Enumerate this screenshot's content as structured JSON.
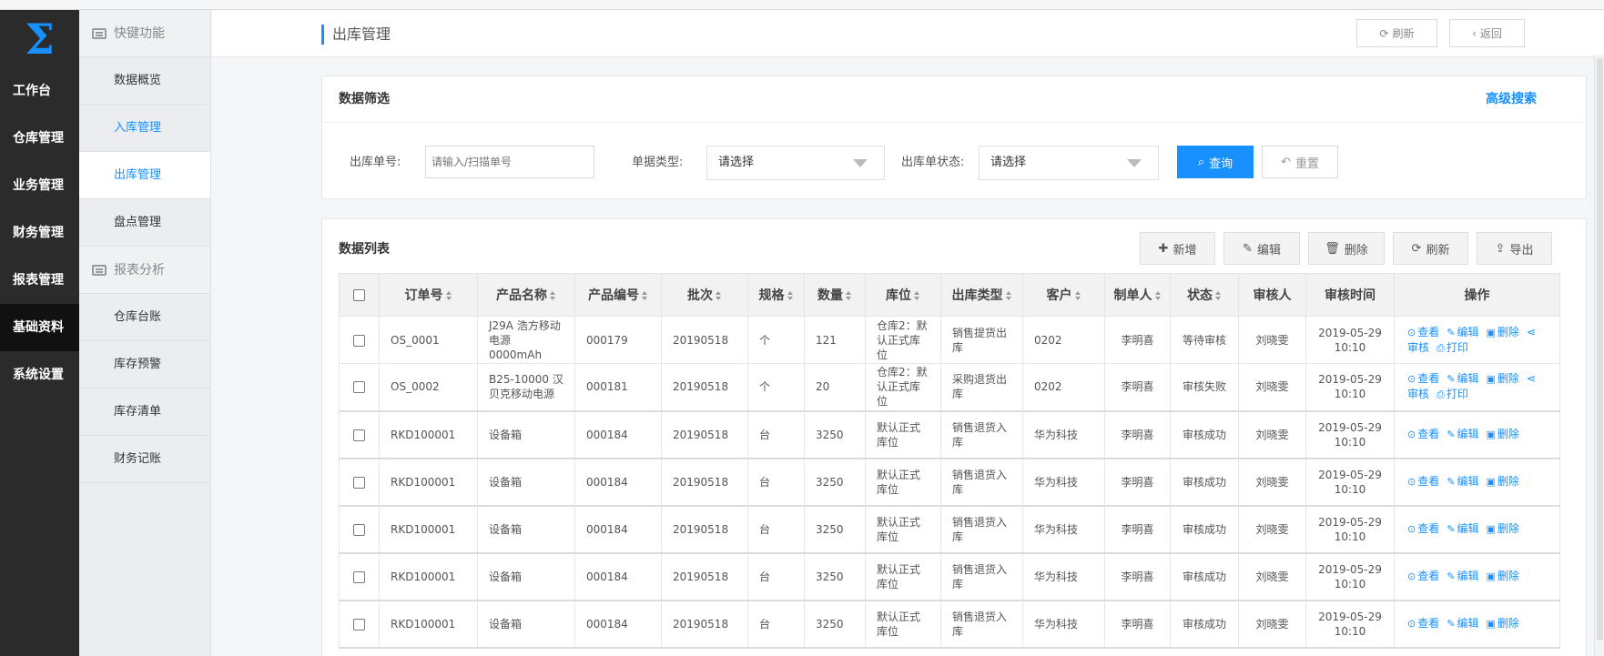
{
  "logo": {
    "glyph": "Σ"
  },
  "nav": [
    {
      "label": "工作台",
      "name": "nav-workbench"
    },
    {
      "label": "仓库管理",
      "name": "nav-warehouse"
    },
    {
      "label": "业务管理",
      "name": "nav-business"
    },
    {
      "label": "财务管理",
      "name": "nav-finance"
    },
    {
      "label": "报表管理",
      "name": "nav-report"
    },
    {
      "label": "基础资料",
      "name": "nav-basic"
    },
    {
      "label": "系统设置",
      "name": "nav-settings"
    }
  ],
  "subnav": {
    "group1": "快键功能",
    "items1": [
      "数据概览",
      "入库管理",
      "出库管理",
      "盘点管理"
    ],
    "group2": "报表分析",
    "items2": [
      "仓库台账",
      "库存预警",
      "库存清单",
      "财务记账"
    ]
  },
  "header": {
    "title": "出库管理",
    "refresh": "刷新",
    "back": "返回"
  },
  "filter": {
    "title": "数据筛选",
    "advanced": "高级搜索",
    "order_label": "出库单号:",
    "order_placeholder": "请输入/扫描单号",
    "type_label": "单据类型:",
    "type_value": "请选择",
    "status_label": "出库单状态:",
    "status_value": "请选择",
    "query": "查询",
    "reset": "重置"
  },
  "list": {
    "title": "数据列表",
    "add": "新增",
    "edit": "编辑",
    "delete": "删除",
    "refresh": "刷新",
    "export": "导出",
    "columns": [
      "订单号",
      "产品名称",
      "产品编号",
      "批次",
      "规格",
      "数量",
      "库位",
      "出库类型",
      "客户",
      "制单人",
      "状态",
      "审核人",
      "审核时间",
      "操作"
    ],
    "op_view": "查看",
    "op_edit": "编辑",
    "op_delete": "删除",
    "op_audit": "审核",
    "op_print": "打印",
    "rows": [
      {
        "order": "OS_0001",
        "product": "J29A 浩方移动电源 0000mAh",
        "code": "000179",
        "batch": "20190518",
        "spec": "个",
        "qty": "121",
        "location": "仓库2：默认正式库位",
        "type": "销售提货出库",
        "customer": "0202",
        "maker": "李明喜",
        "status": "等待审核",
        "auditor": "刘晓雯",
        "time1": "2019-05-29",
        "time2": "10:10",
        "extra": true
      },
      {
        "order": "OS_0002",
        "product": "B25-10000 汉贝克移动电源",
        "code": "000181",
        "batch": "20190518",
        "spec": "个",
        "qty": "20",
        "location": "仓库2：默认正式库位",
        "type": "采购退货出库",
        "customer": "0202",
        "maker": "李明喜",
        "status": "审核失败",
        "auditor": "刘晓雯",
        "time1": "2019-05-29",
        "time2": "10:10",
        "extra": true
      },
      {
        "order": "RKD100001",
        "product": "设备箱",
        "code": "000184",
        "batch": "20190518",
        "spec": "台",
        "qty": "3250",
        "location": "默认正式库位",
        "type": "销售退货入库",
        "customer": "华为科技",
        "maker": "李明喜",
        "status": "审核成功",
        "auditor": "刘晓雯",
        "time1": "2019-05-29",
        "time2": "10:10",
        "extra": false
      },
      {
        "order": "RKD100001",
        "product": "设备箱",
        "code": "000184",
        "batch": "20190518",
        "spec": "台",
        "qty": "3250",
        "location": "默认正式库位",
        "type": "销售退货入库",
        "customer": "华为科技",
        "maker": "李明喜",
        "status": "审核成功",
        "auditor": "刘晓雯",
        "time1": "2019-05-29",
        "time2": "10:10",
        "extra": false
      },
      {
        "order": "RKD100001",
        "product": "设备箱",
        "code": "000184",
        "batch": "20190518",
        "spec": "台",
        "qty": "3250",
        "location": "默认正式库位",
        "type": "销售退货入库",
        "customer": "华为科技",
        "maker": "李明喜",
        "status": "审核成功",
        "auditor": "刘晓雯",
        "time1": "2019-05-29",
        "time2": "10:10",
        "extra": false
      },
      {
        "order": "RKD100001",
        "product": "设备箱",
        "code": "000184",
        "batch": "20190518",
        "spec": "台",
        "qty": "3250",
        "location": "默认正式库位",
        "type": "销售退货入库",
        "customer": "华为科技",
        "maker": "李明喜",
        "status": "审核成功",
        "auditor": "刘晓雯",
        "time1": "2019-05-29",
        "time2": "10:10",
        "extra": false
      },
      {
        "order": "RKD100001",
        "product": "设备箱",
        "code": "000184",
        "batch": "20190518",
        "spec": "台",
        "qty": "3250",
        "location": "默认正式库位",
        "type": "销售退货入库",
        "customer": "华为科技",
        "maker": "李明喜",
        "status": "审核成功",
        "auditor": "刘晓雯",
        "time1": "2019-05-29",
        "time2": "10:10",
        "extra": false
      }
    ]
  },
  "colors": {
    "accent": "#1890ff",
    "sidebar": "#2b2b2b"
  }
}
